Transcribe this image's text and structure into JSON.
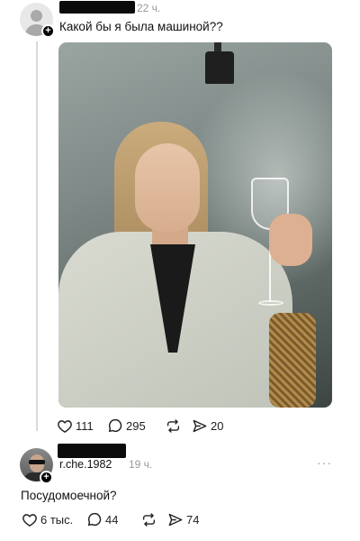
{
  "post1": {
    "time": "22 ч.",
    "caption": "Какой бы я была машиной??",
    "likes": "111",
    "comments": "295",
    "shares": "20"
  },
  "post2": {
    "username": "r.che.1982",
    "time": "19 ч.",
    "more": "···",
    "caption": "Посудомоечной?",
    "likes": "6 тыс.",
    "comments": "44",
    "shares": "74"
  },
  "icons": {
    "like": "heart-icon",
    "comment": "comment-bubble-icon",
    "repost": "repost-icon",
    "share": "send-icon",
    "follow": "plus-icon"
  }
}
